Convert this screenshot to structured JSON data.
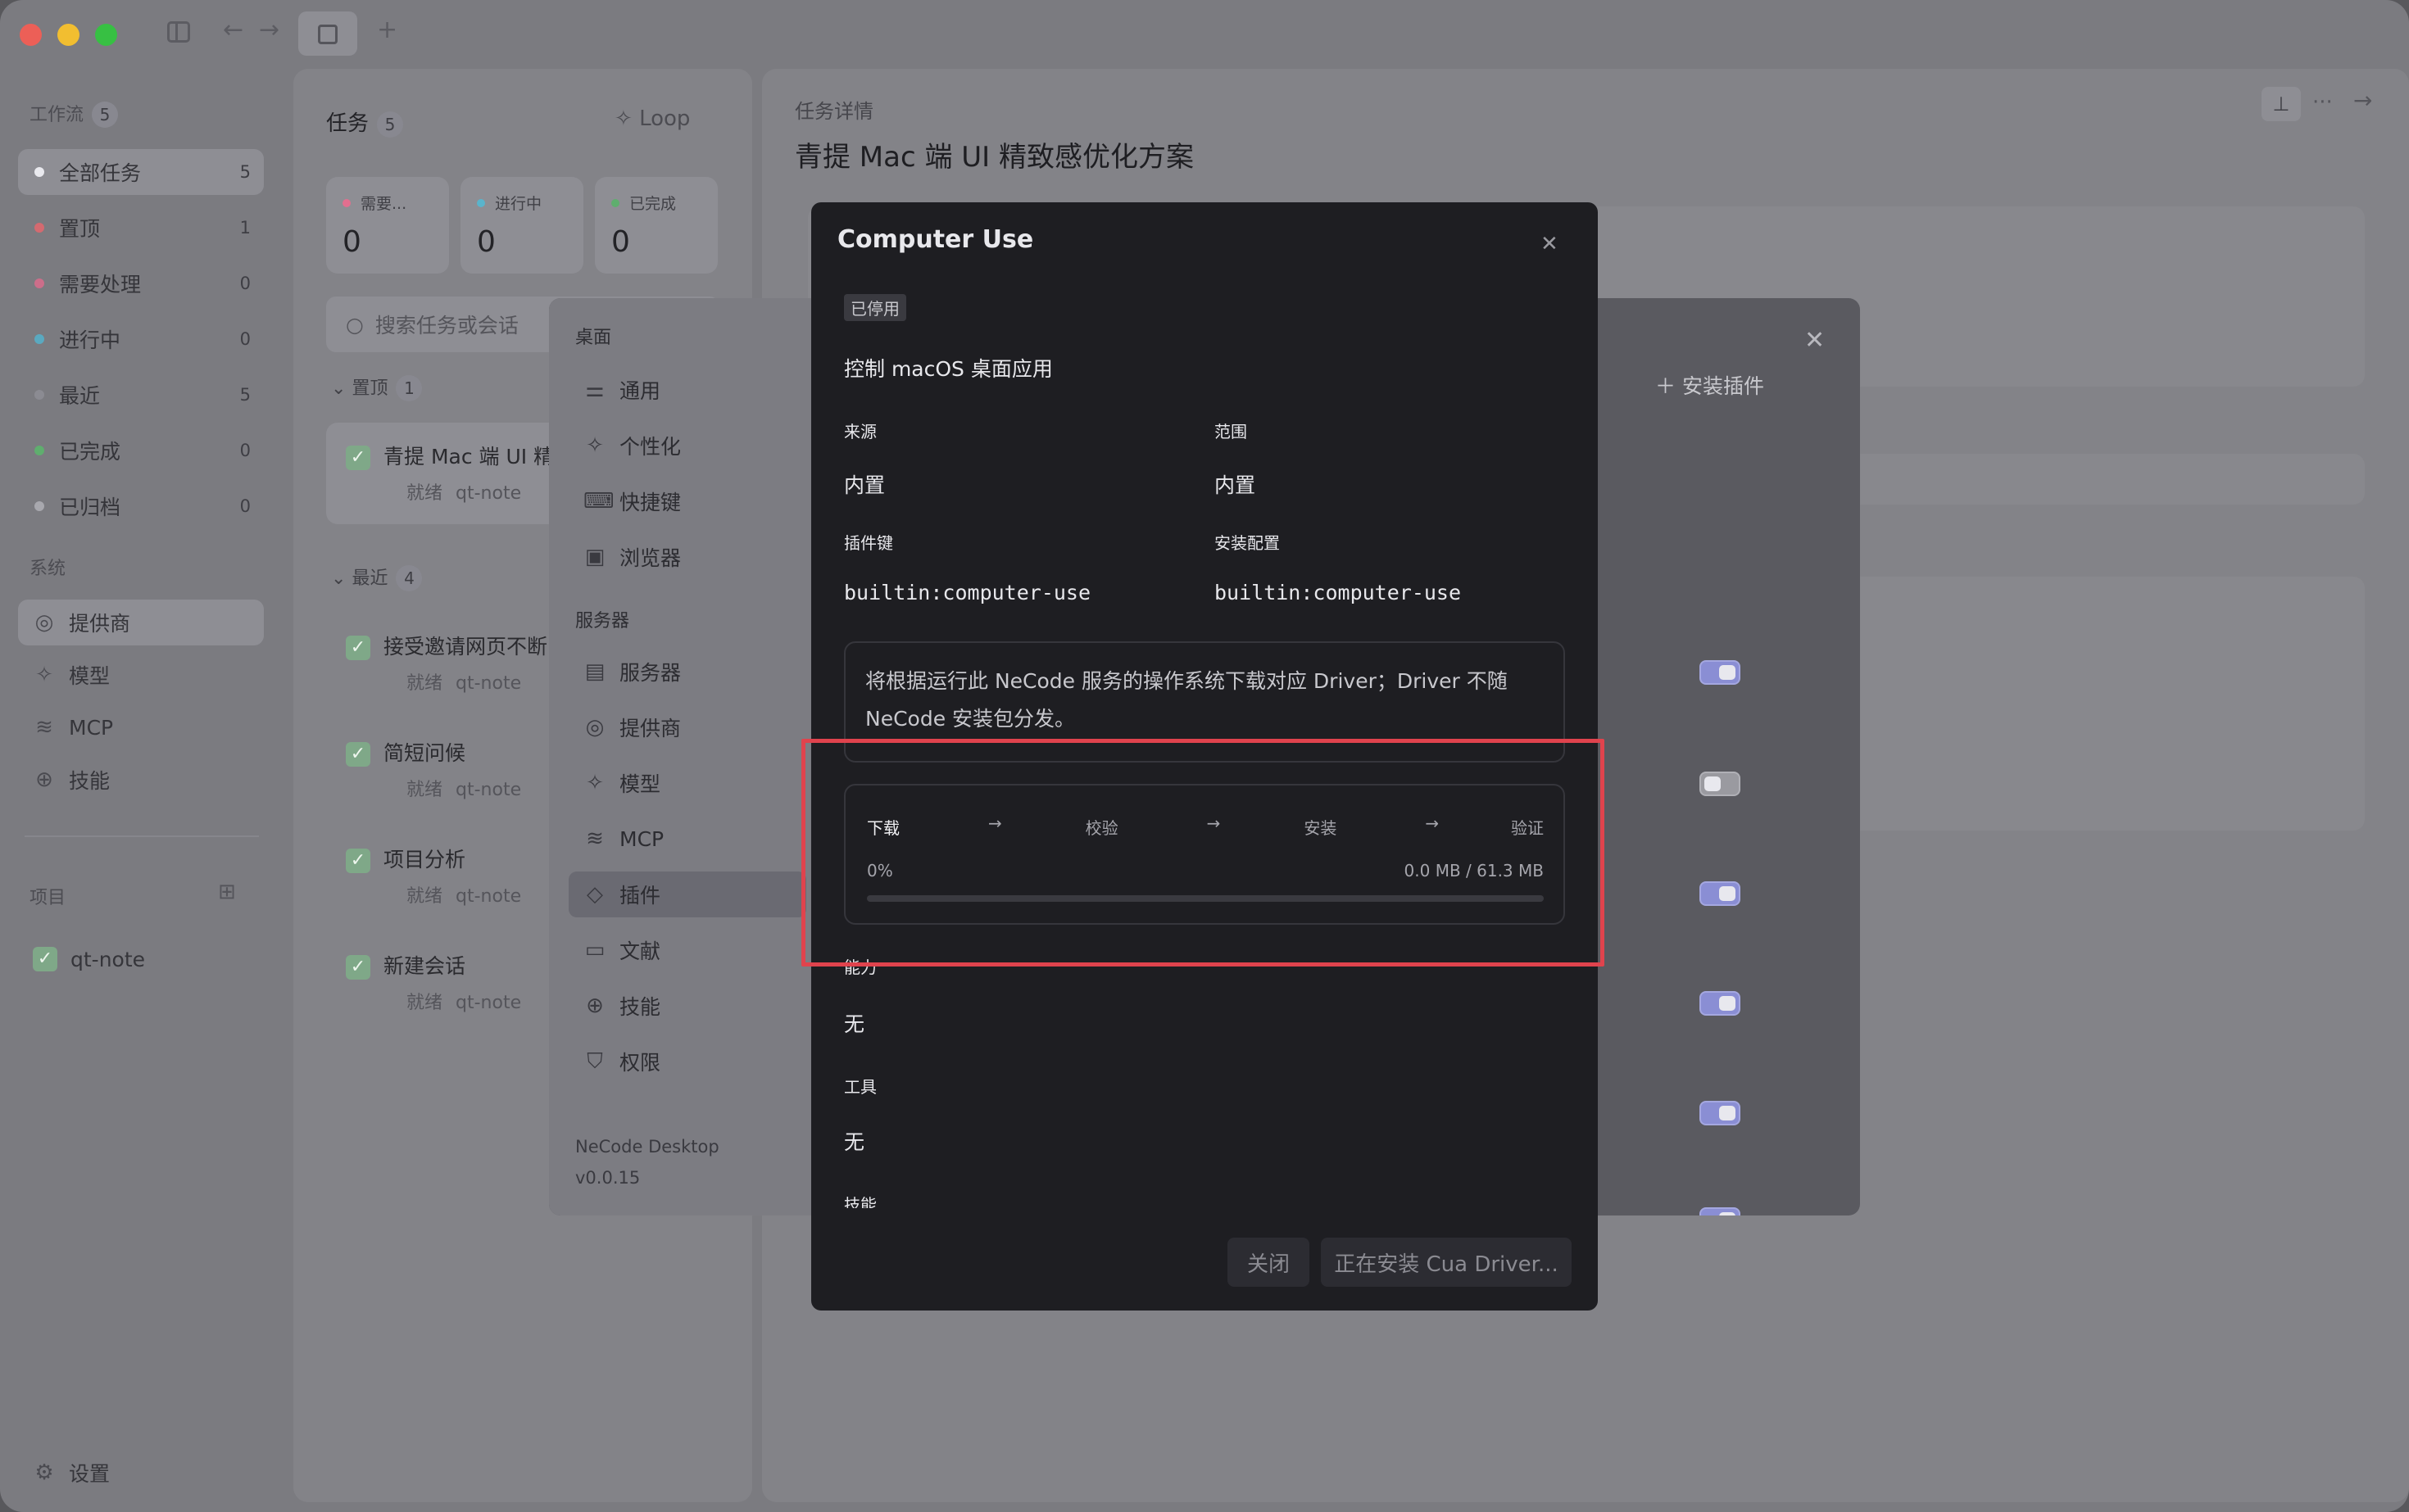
{
  "window": {
    "traffic_lights": [
      "#ec5f57",
      "#f2be30",
      "#37c043"
    ]
  },
  "sidebar": {
    "workflow_label": "工作流",
    "workflow_count": "5",
    "items": [
      {
        "label": "全部任务",
        "count": "5",
        "color": "#e9e9ee"
      },
      {
        "label": "置顶",
        "count": "1",
        "color": "#d46a70"
      },
      {
        "label": "需要处理",
        "count": "0",
        "color": "#cc6e8a"
      },
      {
        "label": "进行中",
        "count": "0",
        "color": "#5aa9c0"
      },
      {
        "label": "最近",
        "count": "5",
        "color": "#8b8b92"
      },
      {
        "label": "已完成",
        "count": "0",
        "color": "#5fae6e"
      },
      {
        "label": "已归档",
        "count": "0",
        "color": "#a8a8ae"
      }
    ],
    "system_label": "系统",
    "system_items": [
      {
        "label": "提供商",
        "icon": "provider-icon"
      },
      {
        "label": "模型",
        "icon": "sparkle-icon"
      },
      {
        "label": "MCP",
        "icon": "mcp-icon"
      },
      {
        "label": "技能",
        "icon": "skills-icon"
      }
    ],
    "projects_label": "项目",
    "project": "qt-note",
    "settings_label": "设置"
  },
  "tasks": {
    "title": "任务",
    "count": "5",
    "loop_label": "Loop",
    "stats": [
      {
        "label": "需要...",
        "value": "0",
        "color": "#e26f8f"
      },
      {
        "label": "进行中",
        "value": "0",
        "color": "#5ab4cc"
      },
      {
        "label": "已完成",
        "value": "0",
        "color": "#5fae6e"
      }
    ],
    "search_placeholder": "搜索任务或会话",
    "pinned_group": {
      "label": "置顶",
      "count": "1"
    },
    "pinned_task": {
      "title": "青提 Mac 端 UI 精",
      "status": "就绪",
      "project": "qt-note"
    },
    "recent_group": {
      "label": "最近",
      "count": "4"
    },
    "recent_tasks": [
      {
        "title": "接受邀请网页不断",
        "status": "就绪",
        "project": "qt-note"
      },
      {
        "title": "简短问候",
        "status": "就绪",
        "project": "qt-note"
      },
      {
        "title": "项目分析",
        "status": "就绪",
        "project": "qt-note"
      },
      {
        "title": "新建会话",
        "status": "就绪",
        "project": "qt-note"
      }
    ]
  },
  "details": {
    "label": "任务详情",
    "title": "青提 Mac 端 UI 精致感优化方案"
  },
  "settings": {
    "desktop_label": "桌面",
    "desktop_items": [
      {
        "label": "通用",
        "icon": "sliders-icon"
      },
      {
        "label": "个性化",
        "icon": "sparkle-icon"
      },
      {
        "label": "快捷键",
        "icon": "keyboard-icon"
      },
      {
        "label": "浏览器",
        "icon": "browser-icon"
      }
    ],
    "server_label": "服务器",
    "server_items": [
      {
        "label": "服务器",
        "icon": "server-icon"
      },
      {
        "label": "提供商",
        "icon": "provider-icon"
      },
      {
        "label": "模型",
        "icon": "sparkle-icon"
      },
      {
        "label": "MCP",
        "icon": "mcp-icon"
      },
      {
        "label": "插件",
        "icon": "plugin-icon"
      },
      {
        "label": "文献",
        "icon": "archive-icon"
      },
      {
        "label": "技能",
        "icon": "skills-icon"
      },
      {
        "label": "权限",
        "icon": "shield-icon"
      }
    ],
    "app_name": "NeCode Desktop",
    "version": "v0.0.15",
    "install_plugin_label": "安装插件"
  },
  "computer_use": {
    "title": "Computer Use",
    "badge": "已停用",
    "description": "控制 macOS 桌面应用",
    "source_label": "来源",
    "source_value": "内置",
    "scope_label": "范围",
    "scope_value": "内置",
    "plugin_key_label": "插件键",
    "plugin_key_value": "builtin:computer-use",
    "install_config_label": "安装配置",
    "install_config_value": "builtin:computer-use",
    "notice": "将根据运行此 NeCode 服务的操作系统下载对应 Driver；Driver 不随 NeCode 安装包分发。",
    "steps": [
      "下载",
      "校验",
      "安装",
      "验证"
    ],
    "progress_percent": "0%",
    "progress_size": "0.0 MB / 61.3 MB",
    "progress_fraction": 0,
    "capabilities_label": "能力",
    "capabilities_value": "无",
    "tools_label": "工具",
    "tools_value": "无",
    "skills_label": "技能",
    "close_button": "关闭",
    "installing_button": "正在安装 Cua Driver..."
  }
}
